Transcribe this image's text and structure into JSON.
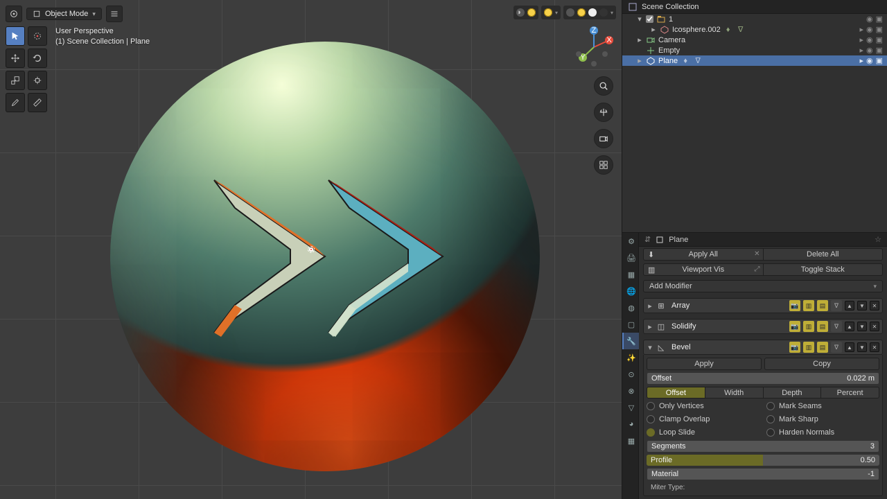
{
  "viewport": {
    "mode": "Object Mode",
    "info_line1": "User Perspective",
    "info_line2": "(1) Scene Collection | Plane"
  },
  "outliner": {
    "root": "Scene Collection",
    "items": [
      {
        "name": "1",
        "type": "collection"
      },
      {
        "name": "Icosphere.002",
        "type": "mesh"
      },
      {
        "name": "Camera",
        "type": "camera"
      },
      {
        "name": "Empty",
        "type": "empty"
      },
      {
        "name": "Plane",
        "type": "mesh",
        "selected": true
      }
    ]
  },
  "properties": {
    "context_name": "Plane",
    "dual1": {
      "left": "Apply All",
      "right": "Delete All"
    },
    "dual2": {
      "left": "Viewport Vis",
      "right": "Toggle Stack"
    },
    "add_modifier": "Add Modifier",
    "mods": [
      {
        "name": "Array",
        "expanded": false
      },
      {
        "name": "Solidify",
        "expanded": false
      },
      {
        "name": "Bevel",
        "expanded": true
      }
    ],
    "apply": "Apply",
    "copy": "Copy",
    "bevel": {
      "offset_label": "Offset",
      "offset_value": "0.022 m",
      "tabs": [
        "Offset",
        "Width",
        "Depth",
        "Percent"
      ],
      "checks_left": [
        "Only Vertices",
        "Clamp Overlap",
        "Loop Slide"
      ],
      "checks_right": [
        "Mark Seams",
        "Mark Sharp",
        "Harden Normals"
      ],
      "check_states_left": [
        false,
        false,
        true
      ],
      "check_states_right": [
        false,
        false,
        false
      ],
      "segments_label": "Segments",
      "segments": "3",
      "profile_label": "Profile",
      "profile": "0.50",
      "material_label": "Material",
      "material": "-1",
      "miter_label": "Miter Type:"
    }
  }
}
